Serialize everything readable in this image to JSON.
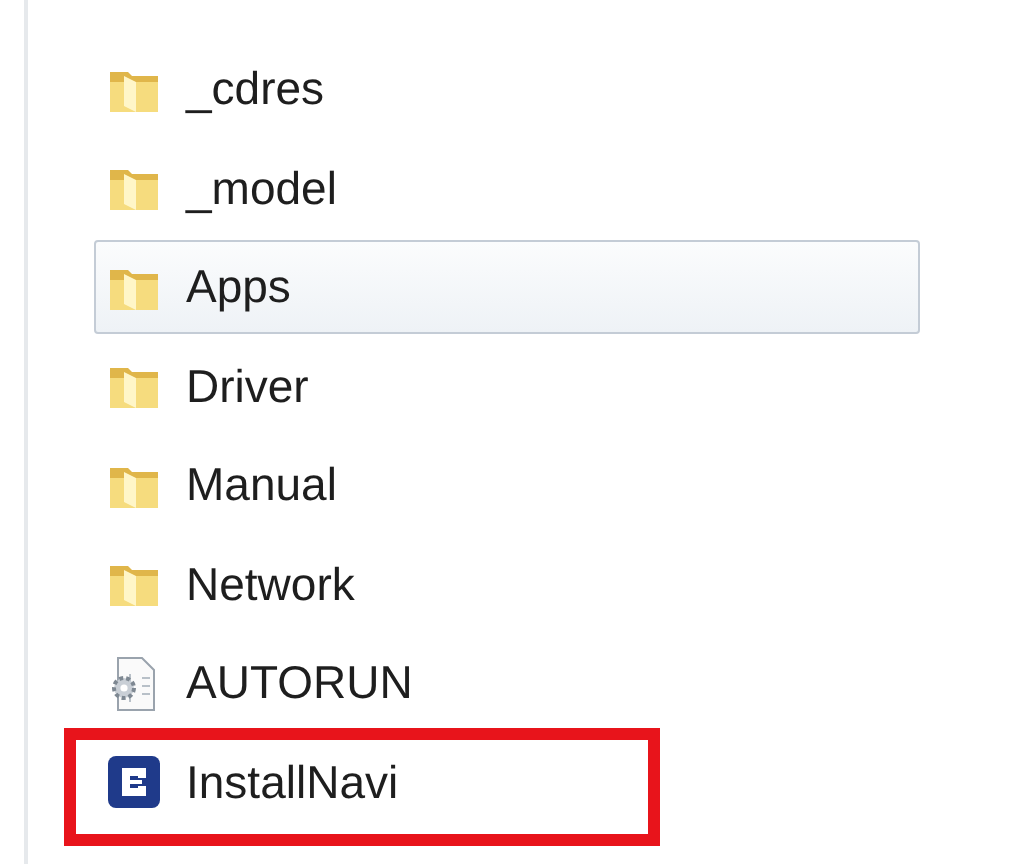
{
  "items": [
    {
      "kind": "folder",
      "name": "_cdres",
      "selected": false,
      "highlighted": false
    },
    {
      "kind": "folder",
      "name": "_model",
      "selected": false,
      "highlighted": false
    },
    {
      "kind": "folder",
      "name": "Apps",
      "selected": true,
      "highlighted": false
    },
    {
      "kind": "folder",
      "name": "Driver",
      "selected": false,
      "highlighted": false
    },
    {
      "kind": "folder",
      "name": "Manual",
      "selected": false,
      "highlighted": false
    },
    {
      "kind": "folder",
      "name": "Network",
      "selected": false,
      "highlighted": false
    },
    {
      "kind": "config",
      "name": "AUTORUN",
      "selected": false,
      "highlighted": false
    },
    {
      "kind": "app",
      "name": "InstallNavi",
      "selected": false,
      "highlighted": true
    }
  ]
}
